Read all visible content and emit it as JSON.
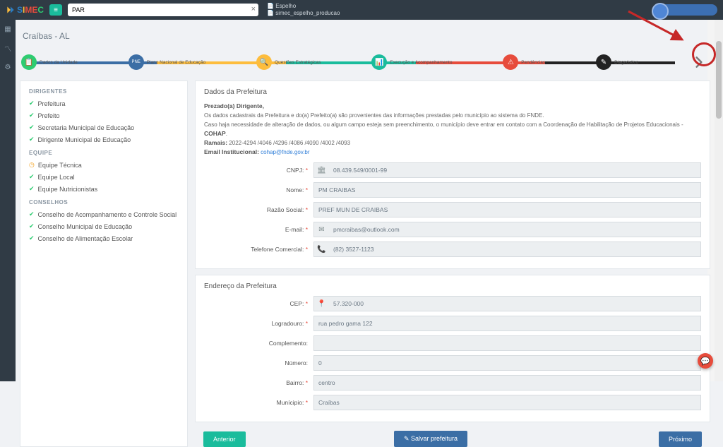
{
  "brand": "SIMEC",
  "module_tag": "≡",
  "search_value": "PAR",
  "crumb1": "Espelho",
  "crumb2": "simec_espelho_producao",
  "page_title": "Craíbas - AL",
  "steps": [
    {
      "label": "Dados da Unidade",
      "icon": "📋"
    },
    {
      "label": "Plano Nacional de Educação",
      "icon": "PNE"
    },
    {
      "label": "Questões Estratégicas",
      "icon": "🔍"
    },
    {
      "label": "Execução e Acompanhamento",
      "icon": "📊"
    },
    {
      "label": "Pendências",
      "icon": "⚠"
    },
    {
      "label": "Diagnóstico",
      "icon": "✎"
    }
  ],
  "sidebar": {
    "g1_title": "DIRIGENTES",
    "g1": [
      {
        "ok": true,
        "label": "Prefeitura"
      },
      {
        "ok": true,
        "label": "Prefeito"
      },
      {
        "ok": true,
        "label": "Secretaria Municipal de Educação"
      },
      {
        "ok": true,
        "label": "Dirigente Municipal de Educação"
      }
    ],
    "g2_title": "EQUIPE",
    "g2": [
      {
        "ok": false,
        "label": "Equipe Técnica"
      },
      {
        "ok": true,
        "label": "Equipe Local"
      },
      {
        "ok": true,
        "label": "Equipe Nutricionistas"
      }
    ],
    "g3_title": "CONSELHOS",
    "g3": [
      {
        "ok": true,
        "label": "Conselho de Acompanhamento e Controle Social"
      },
      {
        "ok": true,
        "label": "Conselho Municipal de Educação"
      },
      {
        "ok": true,
        "label": "Conselho de Alimentação Escolar"
      }
    ]
  },
  "cards": {
    "dados_title": "Dados da Prefeitura",
    "notice_greet": "Prezado(a) Dirigente,",
    "notice_p1": "Os dados cadastrais da Prefeitura e do(a) Prefeito(a) são provenientes das informações prestadas pelo município ao sistema do FNDE.",
    "notice_p2_a": "Caso haja necessidade de alteração de dados, ou algum campo esteja sem preenchimento, o município deve entrar em contato com a Coordenação de Habilitação de Projetos Educacionais - ",
    "notice_p2_b": "COHAP",
    "notice_ramais_lbl": "Ramais:",
    "notice_ramais": " 2022-4294 /4046 /4296 /4086 /4090 /4002 /4093",
    "notice_email_lbl": "Email Institucional:",
    "notice_email": " cohap@fnde.gov.br",
    "endereco_title": "Endereço da Prefeitura"
  },
  "form": {
    "cnpj_lbl": "CNPJ:",
    "cnpj": "08.439.549/0001-99",
    "nome_lbl": "Nome:",
    "nome": "PM CRAIBAS",
    "razao_lbl": "Razão Social:",
    "razao": "PREF MUN DE CRAIBAS",
    "email_lbl": "E-mail:",
    "email": "pmcraibas@outlook.com",
    "tel_lbl": "Telefone Comercial:",
    "tel": "(82) 3527-1123",
    "cep_lbl": "CEP:",
    "cep": "57.320-000",
    "log_lbl": "Logradouro:",
    "log": "rua pedro gama 122",
    "comp_lbl": "Complemento:",
    "comp": "",
    "num_lbl": "Número:",
    "num": "0",
    "bairro_lbl": "Bairro:",
    "bairro": "centro",
    "mun_lbl": "Munícipio:",
    "mun": "Craíbas"
  },
  "buttons": {
    "prev": "Anterior",
    "save": "✎ Salvar prefeitura",
    "next": "Próximo"
  }
}
